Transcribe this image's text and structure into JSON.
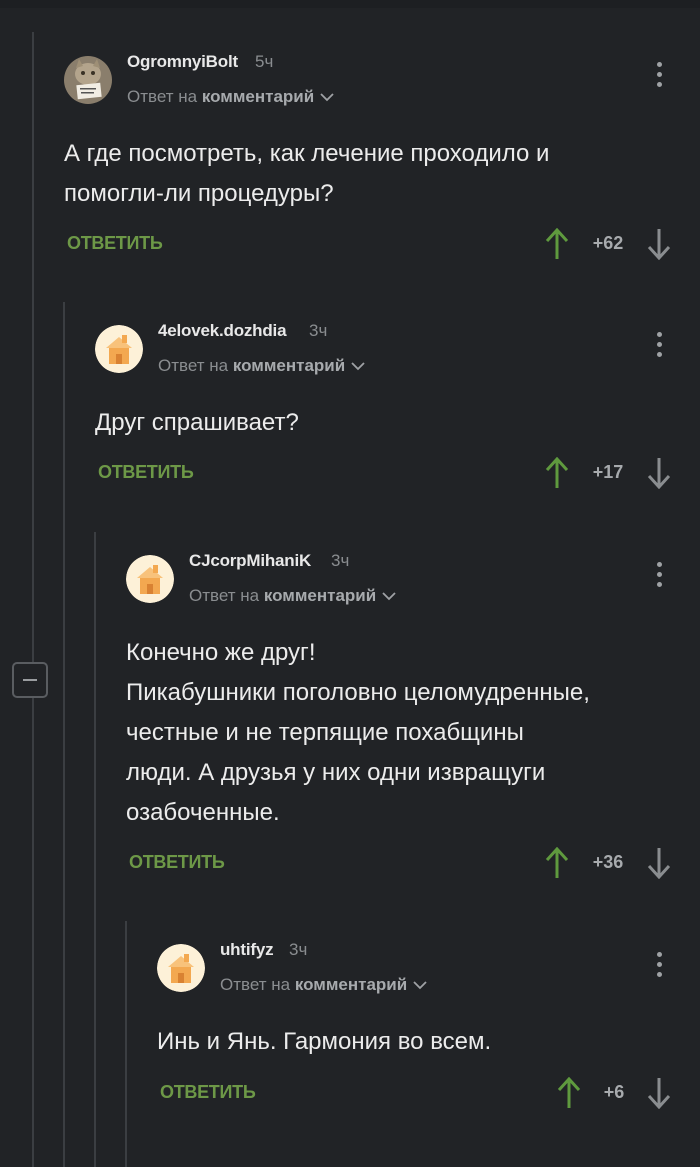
{
  "reply_prefix": "Ответ на",
  "reply_target": "комментарий",
  "reply_label": "ОТВЕТИТЬ",
  "colors": {
    "upvote": "#5f9a3e",
    "reply": "#6d9847",
    "downvote": "#8a8d90"
  },
  "comments": [
    {
      "username": "OgromnyiBolt",
      "time": "5ч",
      "lines": [
        "А где посмотреть, как лечение проходило и",
        "помогли-ли процедуры?"
      ],
      "score": "+62",
      "avatar": "cat-avatar"
    },
    {
      "username": "4elovek.dozhdia",
      "time": "3ч",
      "lines": [
        "Друг спрашивает?"
      ],
      "score": "+17",
      "avatar": "default-house-avatar"
    },
    {
      "username": "CJcorpMihaniK",
      "time": "3ч",
      "lines": [
        "Конечно же друг!",
        "Пикабушники поголовно целомудренные,",
        "честные и не терпящие похабщины",
        "люди. А друзья у них одни извращуги",
        "озабоченные."
      ],
      "score": "+36",
      "avatar": "default-house-avatar"
    },
    {
      "username": "uhtifyz",
      "time": "3ч",
      "lines": [
        "Инь и Янь. Гармония во всем."
      ],
      "score": "+6",
      "avatar": "default-house-avatar"
    }
  ]
}
